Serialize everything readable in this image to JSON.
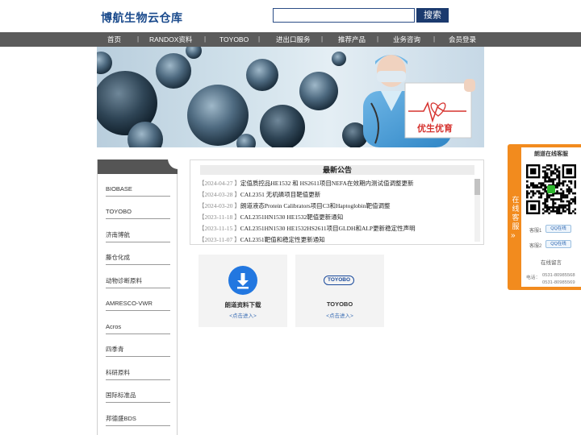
{
  "header": {
    "site_title": "博航生物云仓库",
    "search_placeholder": "",
    "search_button": "搜索"
  },
  "nav": {
    "items": [
      "首页",
      "RANDOX资料",
      "TOYOBO",
      "进出口服务",
      "推荐产品",
      "业务咨询",
      "会员登录"
    ],
    "separator": "|"
  },
  "banner": {
    "sign_text": "优生优育",
    "colors": {
      "sign_text": "#d6332f",
      "heart": "#d6332f"
    }
  },
  "sidebar": {
    "items": [
      "BIOBASE",
      "TOYOBO",
      "济南博航",
      "藤仓化成",
      "动物诊断原料",
      "AMRESCO-VWR",
      "Acros",
      "四季青",
      "科研原料",
      "国际标准品",
      "邦德盛BDS"
    ]
  },
  "news": {
    "title": "最新公告",
    "items": [
      {
        "date": "【2024-04-27 】",
        "text": "定值质控品HE1532 和 HS2611项目NEFA在效期内测试值调整更新"
      },
      {
        "date": "【2024-03-28 】",
        "text": "CAL2351 无机磷项目靶值更新"
      },
      {
        "date": "【2024-03-20 】",
        "text": "朗道液态Protein Calibrators项目C3和Haptoglobin靶值调整"
      },
      {
        "date": "【2023-11-18 】",
        "text": "CAL2351HN1530 HE1532靶值更新通知"
      },
      {
        "date": "【2023-11-15 】",
        "text": "CAL2351HN1530 HE1532HS2611项目GLDH和ALP更新稳定性声明"
      },
      {
        "date": "【2023-11-07 】",
        "text": "CAL2351靶值和稳定性更新通知"
      }
    ]
  },
  "cards": [
    {
      "title": "朗道资料下载",
      "sub": "<点击进入>",
      "icon": "download-icon",
      "color": "#2277e0"
    },
    {
      "title": "TOYOBO",
      "sub": "<点击进入>",
      "logo_text": "TOYOBO",
      "color": "#1a4a9c"
    }
  ],
  "service": {
    "tab_text": "在线客服",
    "tab_arrow": "»",
    "title": "朗道在线客服",
    "agents": [
      {
        "label": "客服1",
        "button": "QQ在线"
      },
      {
        "label": "客服2",
        "button": "QQ在线"
      }
    ],
    "message": "在线留言",
    "phone_label": "电话：",
    "phones": [
      "0531-80985568",
      "0531-80985569"
    ]
  },
  "colors": {
    "nav_bg": "#5b5b5b",
    "accent": "#1b3a6e",
    "service_panel": "#f28b1e"
  }
}
